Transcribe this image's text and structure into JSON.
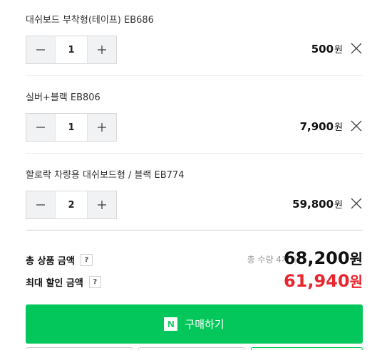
{
  "items": [
    {
      "name": "대쉬보드 부착형(테이프) EB686",
      "quantity": "1",
      "price": "500",
      "currency": "원"
    },
    {
      "name": "실버+블랙 EB806",
      "quantity": "1",
      "price": "7,900",
      "currency": "원"
    },
    {
      "name": "할로락 차량용 대쉬보드형 / 블랙 EB774",
      "quantity": "2",
      "price": "59,800",
      "currency": "원"
    }
  ],
  "summary": {
    "total_label": "총 상품 금액",
    "total_count": "총 수량 4개",
    "total_price": "68,200",
    "discount_label": "최대 할인 금액",
    "discount_price": "61,940",
    "currency": "원",
    "help_mark": "?"
  },
  "buy": {
    "label": "구매하기",
    "logo_letter": "N"
  },
  "colors": {
    "accent_green": "#03c75a",
    "discount_red": "#e8262e"
  }
}
